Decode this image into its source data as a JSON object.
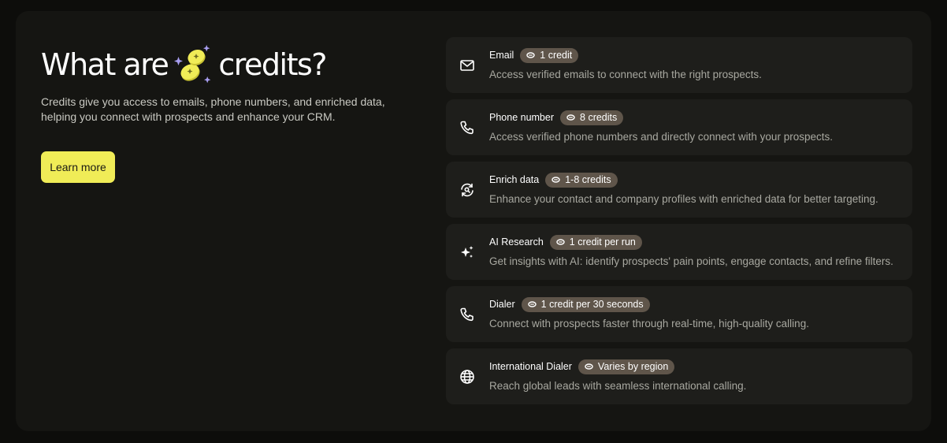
{
  "hero": {
    "title_before": "What are",
    "title_after": "credits?",
    "coin_icon": "coins-icon",
    "description": "Credits give you access to emails, phone numbers, and enriched data, helping you connect with prospects and enhance your CRM.",
    "cta_label": "Learn more"
  },
  "colors": {
    "accent": "#f0ec57",
    "badge": "#5f554a",
    "card": "#1e1e1b",
    "panel": "#151512"
  },
  "items": [
    {
      "icon": "mail-icon",
      "title": "Email",
      "cost": "1 credit",
      "description": "Access verified emails to connect with the right prospects."
    },
    {
      "icon": "phone-icon",
      "title": "Phone number",
      "cost": "8 credits",
      "description": "Access verified phone numbers and directly connect with your prospects."
    },
    {
      "icon": "refresh-search-icon",
      "title": "Enrich data",
      "cost": "1-8 credits",
      "description": "Enhance your contact and company profiles with enriched data for better targeting."
    },
    {
      "icon": "sparkle-icon",
      "title": "AI Research",
      "cost": "1 credit per run",
      "description": "Get insights with AI: identify prospects' pain points, engage contacts, and refine filters."
    },
    {
      "icon": "phone-icon",
      "title": "Dialer",
      "cost": "1 credit per 30 seconds",
      "description": "Connect with prospects faster through real-time, high-quality calling."
    },
    {
      "icon": "globe-icon",
      "title": "International Dialer",
      "cost": "Varies by region",
      "description": "Reach global leads with seamless international calling."
    }
  ]
}
